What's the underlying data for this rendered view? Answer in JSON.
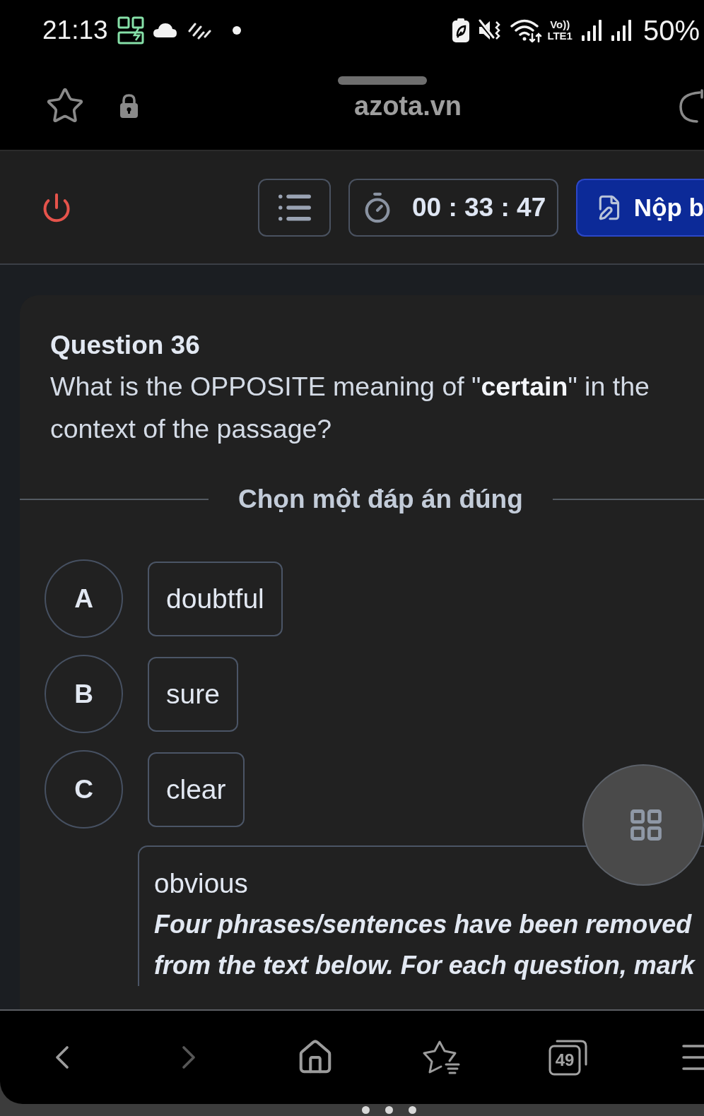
{
  "status_bar": {
    "time": "21:13",
    "volte": "Vo))",
    "network": "LTE1",
    "battery": "50%"
  },
  "browser": {
    "url": "azota.vn"
  },
  "exam_header": {
    "timer": "00 : 33 : 47",
    "submit_label": "Nộp b"
  },
  "question": {
    "title": "Question 36",
    "text": "What is the OPPOSITE meaning of \"**certain**\" in the context of the passage?",
    "instruction": "Chọn một đáp án đúng",
    "options": [
      {
        "letter": "A",
        "text": "doubtful",
        "selected": false
      },
      {
        "letter": "B",
        "text": "sure",
        "selected": false
      },
      {
        "letter": "C",
        "text": "clear",
        "selected": false
      },
      {
        "text": "obvious",
        "note": "Four phrases/sentences have been removed from the text below. For each question, mark",
        "selected": false
      }
    ]
  },
  "bottom_nav": [
    {
      "kind": "back",
      "disabled": false
    },
    {
      "kind": "forward",
      "disabled": true
    },
    {
      "kind": "home",
      "disabled": false
    },
    {
      "kind": "bookmarks",
      "disabled": false
    },
    {
      "kind": "tabs",
      "count": "49",
      "disabled": false
    },
    {
      "kind": "menu",
      "disabled": false
    }
  ]
}
